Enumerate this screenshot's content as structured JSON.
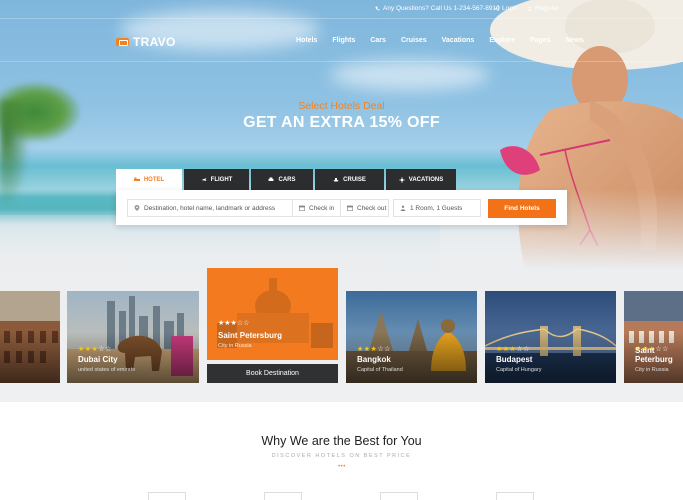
{
  "topbar": {
    "question_text": "Any Questions? Call Us 1-234-567-8910",
    "login_label": "Login",
    "register_label": "Register"
  },
  "brand": {
    "name": "TRAVO",
    "accent": "#f58220"
  },
  "menu": [
    "Hotels",
    "Flights",
    "Cars",
    "Cruises",
    "Vacations",
    "Explore",
    "Pages",
    "News"
  ],
  "hero": {
    "deal_text": "Select Hotels Deal",
    "headline": "GET AN EXTRA 15% OFF"
  },
  "search": {
    "tabs": [
      {
        "label": "HOTEL",
        "icon": "bed-icon",
        "active": true
      },
      {
        "label": "FLIGHT",
        "icon": "plane-icon",
        "active": false
      },
      {
        "label": "CARS",
        "icon": "car-icon",
        "active": false
      },
      {
        "label": "CRUISE",
        "icon": "ship-icon",
        "active": false
      },
      {
        "label": "VACATIONS",
        "icon": "sun-icon",
        "active": false
      }
    ],
    "destination_placeholder": "Destination, hotel name, landmark or address",
    "checkin_label": "Check in",
    "checkout_label": "Check out",
    "guests_value": "1 Room, 1 Guests",
    "find_button": "Find Hotels"
  },
  "destinations": [
    {
      "name": "",
      "sub": "",
      "stars": 0
    },
    {
      "name": "Dubai City",
      "sub": "united states of emirate",
      "stars": 3
    },
    {
      "name": "Saint Petersburg",
      "sub": "City in Russia",
      "stars": 3
    },
    {
      "name": "Bangkok",
      "sub": "Capital of Thailand",
      "stars": 3
    },
    {
      "name": "Budapest",
      "sub": "Capital of Hungary",
      "stars": 3
    },
    {
      "name": "Saint Peterburg",
      "sub": "City in Russia",
      "stars": 3
    }
  ],
  "book_button": "Book Destination",
  "section": {
    "title": "Why We are the Best for You",
    "subtitle": "DISCOVER HOTELS ON BEST PRICE",
    "dots": "•••"
  }
}
